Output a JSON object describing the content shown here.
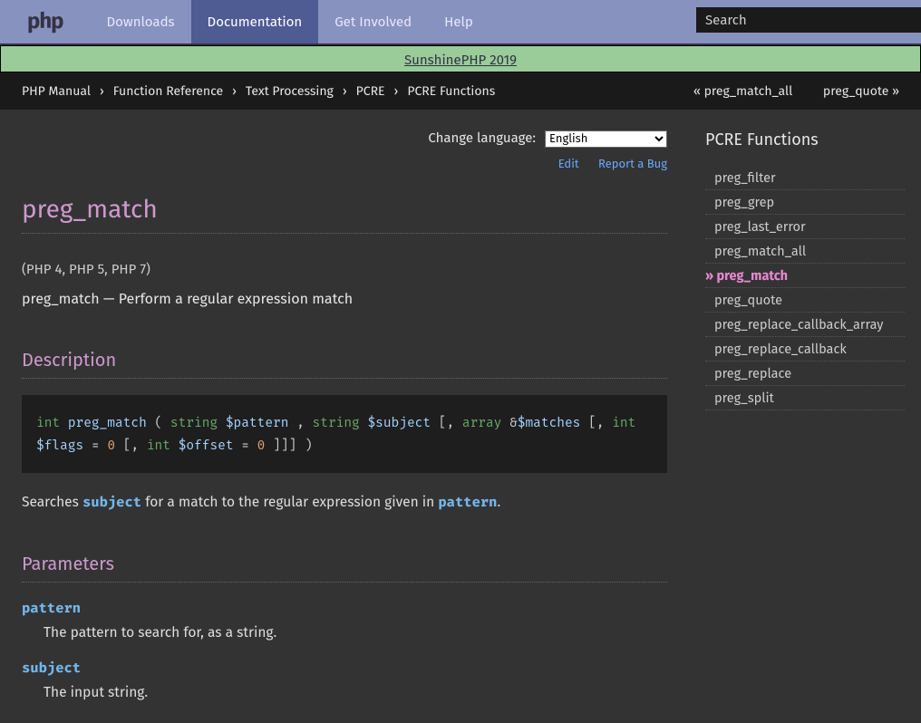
{
  "topnav": {
    "logo": "php",
    "items": [
      "Downloads",
      "Documentation",
      "Get Involved",
      "Help"
    ],
    "active_index": 1,
    "search_placeholder": "Search"
  },
  "banner": {
    "text": "SunshinePHP 2019"
  },
  "breadcrumbs": [
    "PHP Manual",
    "Function Reference",
    "Text Processing",
    "PCRE",
    "PCRE Functions"
  ],
  "prevnext": {
    "prev": "« preg_match_all",
    "next": "preg_quote »"
  },
  "langselect": {
    "label": "Change language:",
    "selected": "English"
  },
  "editlinks": {
    "edit": "Edit",
    "report": "Report a Bug"
  },
  "page": {
    "title": "preg_match",
    "verinfo": "(PHP 4, PHP 5, PHP 7)",
    "purpose_name": "preg_match",
    "purpose_dash": " — ",
    "purpose_text": "Perform a regular expression match",
    "desc_heading": "Description",
    "synopsis": {
      "ret_type": "int",
      "name": "preg_match",
      "open": " ( ",
      "p1_type": "string",
      "p1_var": "$pattern",
      "comma1": " , ",
      "p2_type": "string",
      "p2_var": "$subject",
      "opt_open1": " [, ",
      "p3_type": "array",
      "p3_ref": "&",
      "p3_var": "$matches",
      "opt_open2": " [, ",
      "p4_type": "int",
      "p4_var": "$flags",
      "p4_eq": " = ",
      "p4_init": "0",
      "opt_open3": " [, ",
      "p5_type": "int",
      "p5_var": "$offset",
      "p5_eq": " = ",
      "p5_init": "0",
      "opt_close": " ]]] )"
    },
    "searches": {
      "pre": "Searches ",
      "subject": "subject",
      "mid": " for a match to the regular expression given in ",
      "pattern": "pattern",
      "post": "."
    },
    "params_heading": "Parameters",
    "params": {
      "pattern": {
        "name": "pattern",
        "desc": "The pattern to search for, as a string."
      },
      "subject": {
        "name": "subject",
        "desc": "The input string."
      }
    }
  },
  "sidebar": {
    "title": "PCRE Functions",
    "items": [
      "preg_filter",
      "preg_grep",
      "preg_last_error",
      "preg_match_all",
      "preg_match",
      "preg_quote",
      "preg_replace_callback_array",
      "preg_replace_callback",
      "preg_replace",
      "preg_split"
    ],
    "current_index": 4,
    "arrow": "» "
  }
}
